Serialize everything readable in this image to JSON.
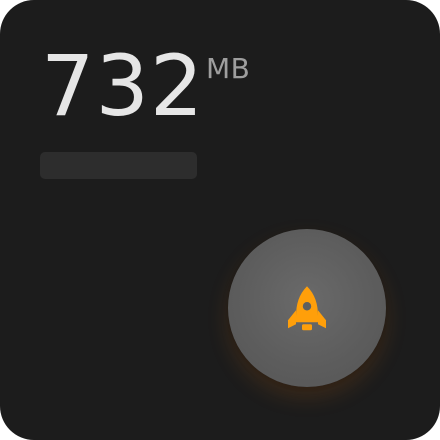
{
  "widget": {
    "memory_value": "732",
    "memory_unit": "MB",
    "usage_fraction": 0
  },
  "boost_button": {
    "icon": "rocket-icon",
    "icon_color": "#ff9f0a"
  },
  "colors": {
    "background": "#1c1c1c",
    "accent": "#ff9f0a"
  }
}
